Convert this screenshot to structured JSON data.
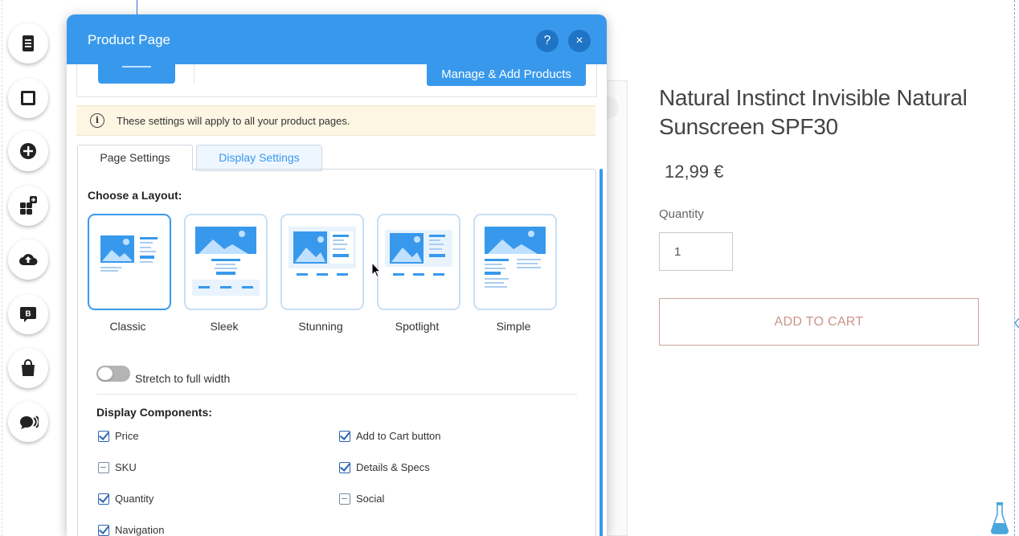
{
  "canvas": {
    "url_hint": "..."
  },
  "toolbar": {
    "items": [
      {
        "name": "pages-icon"
      },
      {
        "name": "background-icon"
      },
      {
        "name": "add-icon"
      },
      {
        "name": "add-apps-icon"
      },
      {
        "name": "upload-icon"
      },
      {
        "name": "blog-icon"
      },
      {
        "name": "store-icon"
      },
      {
        "name": "marketing-icon"
      }
    ]
  },
  "modal": {
    "title": "Product Page",
    "help_label": "?",
    "close_label": "×",
    "manage_button": "Manage & Add Products",
    "notice": "These settings will apply to all your product pages.",
    "notice_icon": "i",
    "tabs": [
      {
        "label": "Page Settings",
        "active": true
      },
      {
        "label": "Display Settings",
        "active": false
      }
    ],
    "layout_heading": "Choose a Layout:",
    "layouts": [
      {
        "label": "Classic",
        "selected": true
      },
      {
        "label": "Sleek",
        "selected": false
      },
      {
        "label": "Stunning",
        "selected": false
      },
      {
        "label": "Spotlight",
        "selected": false
      },
      {
        "label": "Simple",
        "selected": false
      }
    ],
    "stretch_label": "Stretch to full width",
    "stretch_on": false,
    "components_heading": "Display Components:",
    "components": [
      {
        "label": "Price",
        "checked": true
      },
      {
        "label": "Add to Cart button",
        "checked": true
      },
      {
        "label": "SKU",
        "checked": false
      },
      {
        "label": "Details & Specs",
        "checked": true
      },
      {
        "label": "Quantity",
        "checked": true
      },
      {
        "label": "Social",
        "checked": false
      },
      {
        "label": "Navigation",
        "checked": true
      }
    ]
  },
  "product": {
    "title": "Natural Instinct Invisible Natural Sunscreen SPF30",
    "price": "12,99 €",
    "quantity_label": "Quantity",
    "quantity_value": "1",
    "add_to_cart": "ADD TO CART"
  },
  "colors": {
    "accent": "#3899ec",
    "header": "#3899ec",
    "notice_bg": "#fdf6e3",
    "cart_border": "#c9a79d"
  }
}
